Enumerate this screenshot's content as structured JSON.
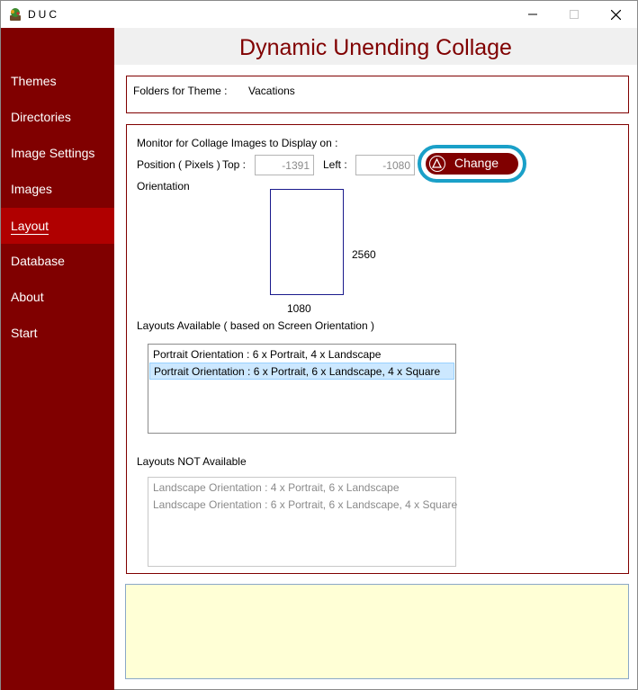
{
  "window": {
    "title": "DUC"
  },
  "sidebar": {
    "items": [
      {
        "label": "Themes"
      },
      {
        "label": "Directories"
      },
      {
        "label": "Image Settings"
      },
      {
        "label": "Images"
      },
      {
        "label": "Layout"
      },
      {
        "label": "Database"
      },
      {
        "label": "About"
      },
      {
        "label": "Start"
      }
    ],
    "active": "Layout"
  },
  "header": {
    "title": "Dynamic Unending Collage"
  },
  "theme": {
    "label": "Folders for Theme :",
    "value": "Vacations"
  },
  "monitor": {
    "heading": "Monitor for Collage Images to Display on :",
    "position_label": "Position ( Pixels )",
    "top_label": "Top :",
    "top_value": "-1391",
    "left_label": "Left :",
    "left_value": "-1080",
    "change_label": "Change",
    "orientation_label": "Orientation",
    "height_value": "2560",
    "width_value": "1080"
  },
  "layouts_available": {
    "heading": "Layouts Available ( based on Screen Orientation )",
    "items": [
      "Portrait Orientation : 6 x Portrait, 4 x Landscape",
      "Portrait Orientation : 6 x Portrait, 6 x Landscape, 4 x Square"
    ],
    "selected_index": 1
  },
  "layouts_not_available": {
    "heading": "Layouts NOT Available",
    "items": [
      "Landscape Orientation : 4 x Portrait, 6 x Landscape",
      "Landscape Orientation : 6 x Portrait, 6 x Landscape, 4 x Square"
    ]
  },
  "colors": {
    "sidebar": "#800000",
    "sidebar_active": "#b00000",
    "accent": "#800000",
    "highlight_ring": "#1aa0c8",
    "message_bg": "#ffffd6"
  },
  "icons": {
    "app": "duc-app-icon",
    "change": "triangle-warning-icon"
  }
}
